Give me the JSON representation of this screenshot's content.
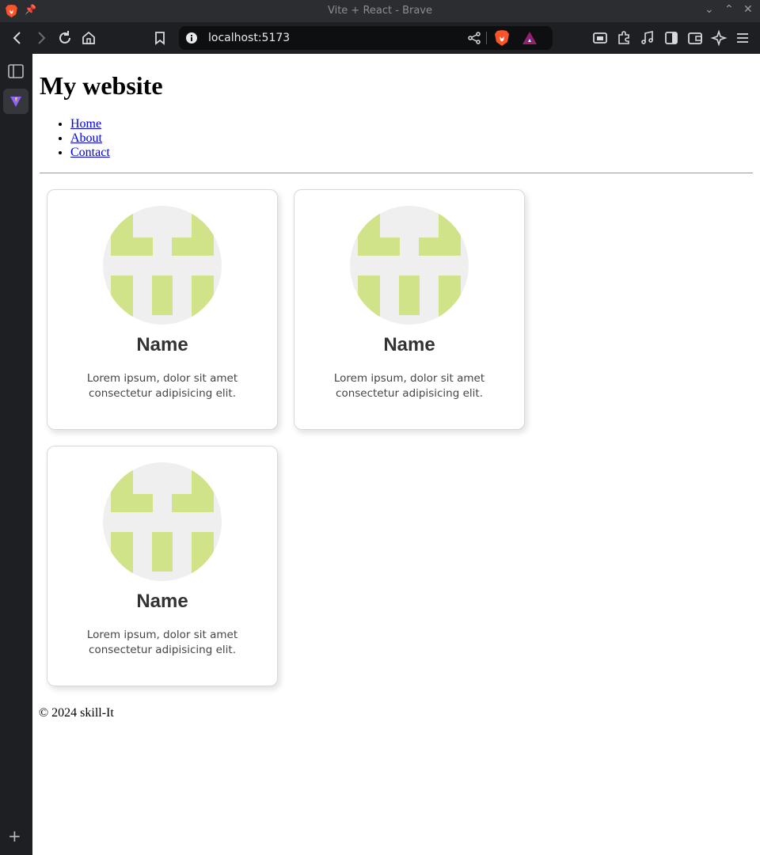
{
  "browser": {
    "window_title": "Vite + React - Brave",
    "url": "localhost:5173"
  },
  "page": {
    "heading": "My website",
    "nav": [
      {
        "label": "Home"
      },
      {
        "label": "About"
      },
      {
        "label": "Contact"
      }
    ],
    "cards": [
      {
        "name": "Name",
        "description": "Lorem ipsum, dolor sit amet consectetur adipisicing elit."
      },
      {
        "name": "Name",
        "description": "Lorem ipsum, dolor sit amet consectetur adipisicing elit."
      },
      {
        "name": "Name",
        "description": "Lorem ipsum, dolor sit amet consectetur adipisicing elit."
      }
    ],
    "footer": "© 2024 skill-It"
  },
  "colors": {
    "avatar_bg": "#efefef",
    "avatar_pattern": "#d1e388",
    "link": "#0000ee",
    "brave_orange": "#fb542b"
  }
}
